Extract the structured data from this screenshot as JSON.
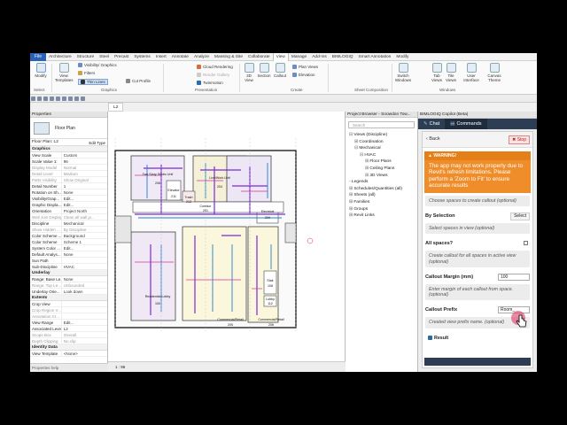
{
  "menu": {
    "file": "File",
    "tabs": [
      "Architecture",
      "Structure",
      "Steel",
      "Precast",
      "Systems",
      "Insert",
      "Annotate",
      "Analyze",
      "Massing & Site",
      "Collaborate",
      "View",
      "Manage",
      "Add-Ins",
      "BIMLOGIQ",
      "Smart Annotation",
      "Modify"
    ],
    "active_tab": "View"
  },
  "ribbon": {
    "modify": "Modify",
    "view_templates": "View Templates",
    "visibility_graphics": "Visibility/ Graphics",
    "filters": "Filters",
    "thin_lines": "Thin Lines",
    "cut_profile": "Cut Profile",
    "cloud_rendering": "Cloud Rendering",
    "render_gallery": "Render Gallery",
    "twinmotion": "Twinmotion",
    "view_3d": "3D View",
    "section": "Section",
    "callout": "Callout",
    "plan_views": "Plan Views",
    "elevation": "Elevation",
    "switch_windows": "Switch Windows",
    "tab_views": "Tab Views",
    "tile_views": "Tile Views",
    "user_interface": "User Interface",
    "canvas_theme": "Canvas Theme",
    "group_select": "Select",
    "group_graphics": "Graphics",
    "group_presentation": "Presentation",
    "group_create": "Create",
    "group_sheet": "Sheet Composition",
    "group_windows": "Windows"
  },
  "properties": {
    "header": "Properties",
    "type_name": "Floor Plan",
    "selector": "Floor Plan: L2",
    "edit_type": "Edit Type",
    "sections": {
      "graphics": "Graphics",
      "underlay": "Underlay",
      "extents": "Extents",
      "identity": "Identity Data"
    },
    "rows_graphics": [
      {
        "k": "View Scale",
        "v": "Custom"
      },
      {
        "k": "Scale Value 1:",
        "v": "96"
      },
      {
        "k": "Display Model",
        "v": "Normal"
      },
      {
        "k": "Detail Level",
        "v": "Medium"
      },
      {
        "k": "Parts Visibility",
        "v": "Show Original"
      },
      {
        "k": "Detail Number",
        "v": "1"
      },
      {
        "k": "Rotation on Sh...",
        "v": "None"
      },
      {
        "k": "Visibility/Grap...",
        "v": "Edit..."
      },
      {
        "k": "Graphic Displa...",
        "v": "Edit..."
      },
      {
        "k": "Orientation",
        "v": "Project North"
      },
      {
        "k": "Wall Join Display",
        "v": "Clean all wall jo..."
      },
      {
        "k": "Discipline",
        "v": "Mechanical"
      },
      {
        "k": "Show Hidden ...",
        "v": "By Discipline"
      },
      {
        "k": "Color Scheme ...",
        "v": "Background"
      },
      {
        "k": "Color Scheme",
        "v": "Scheme 1"
      },
      {
        "k": "System Color ...",
        "v": "Edit..."
      },
      {
        "k": "Default Analys...",
        "v": "None"
      },
      {
        "k": "Sun Path",
        "v": ""
      },
      {
        "k": "Sub-Discipline",
        "v": "HVAC"
      }
    ],
    "rows_underlay": [
      {
        "k": "Range: Base Le...",
        "v": "None"
      },
      {
        "k": "Range: Top Le...",
        "v": "Unbounded"
      },
      {
        "k": "Underlay Orie...",
        "v": "Look down"
      }
    ],
    "rows_extents": [
      {
        "k": "Crop View",
        "v": ""
      },
      {
        "k": "Crop Region V...",
        "v": ""
      },
      {
        "k": "Annotation Cr...",
        "v": ""
      },
      {
        "k": "View Range",
        "v": "Edit..."
      },
      {
        "k": "Associated Level",
        "v": "L2"
      },
      {
        "k": "Scope Box",
        "v": "Overall"
      },
      {
        "k": "Depth Clipping",
        "v": "No clip"
      }
    ],
    "rows_identity": [
      {
        "k": "View Template",
        "v": "<None>"
      }
    ],
    "status": "Properties help",
    "apply": "Apply"
  },
  "canvas": {
    "tab1": "L2",
    "tab2": "",
    "scale": "1 : 96",
    "rooms": [
      {
        "name": "Two Story Studio Unit",
        "num": "208"
      },
      {
        "name": "Live/Work Unit",
        "num": "204"
      },
      {
        "name": "Elevator",
        "num": "211"
      },
      {
        "name": "Trash",
        "num": "213"
      },
      {
        "name": "Electrical",
        "num": "209"
      },
      {
        "name": "Corridor",
        "num": "201"
      },
      {
        "name": "Residential Lobby",
        "num": "100"
      },
      {
        "name": "Stair",
        "num": "108"
      },
      {
        "name": "Lobby",
        "num": "112"
      },
      {
        "name": "Commercial/Retail",
        "num": "205"
      },
      {
        "name": "Commercial/Retail",
        "num": "206"
      }
    ]
  },
  "browser": {
    "header": "Project Browser - Snowdon Tow...",
    "search_placeholder": "Search",
    "tree": [
      {
        "label": "Views (Discipline)",
        "depth": 0,
        "state": "open"
      },
      {
        "label": "Coordination",
        "depth": 1,
        "state": "closed"
      },
      {
        "label": "Mechanical",
        "depth": 1,
        "state": "open"
      },
      {
        "label": "HVAC",
        "depth": 2,
        "state": "open"
      },
      {
        "label": "Floor Plans",
        "depth": 3,
        "state": "closed"
      },
      {
        "label": "Ceiling Plans",
        "depth": 3,
        "state": "closed"
      },
      {
        "label": "3D Views",
        "depth": 3,
        "state": "closed"
      },
      {
        "label": "Legends",
        "depth": 0,
        "state": "leaf"
      },
      {
        "label": "Schedules/Quantities (all)",
        "depth": 0,
        "state": "closed"
      },
      {
        "label": "Sheets (all)",
        "depth": 0,
        "state": "closed"
      },
      {
        "label": "Families",
        "depth": 0,
        "state": "closed"
      },
      {
        "label": "Groups",
        "depth": 0,
        "state": "closed"
      },
      {
        "label": "Revit Links",
        "depth": 0,
        "state": "closed"
      }
    ]
  },
  "copilot": {
    "title": "BIMLOGIQ Copilot (Beta)",
    "tab_chat": "Chat",
    "tab_commands": "Commands",
    "back": "Back",
    "stop": "Stop",
    "warning_header": "WARNING!",
    "warning_text": "The app may not work properly due to Revit's refresh limitations. Please perform a 'Zoom to Fit' to ensure accurate results",
    "hint_choose": "Choose spaces to create callout (optional)",
    "by_selection_label": "By Selection",
    "select_button": "Select",
    "hint_select": "Select spaces in view (optional)",
    "all_spaces_label": "All spaces?",
    "hint_all": "Create callout for all spaces in active view (optional)",
    "margin_label": "Callout Margin (mm)",
    "margin_value": "100",
    "hint_margin": "Enter margin of each callout from space. (optional)",
    "prefix_label": "Callout Prefix",
    "prefix_value": "Room_",
    "hint_prefix": "Created view prefix name. (optional)",
    "result_label": "Result"
  }
}
